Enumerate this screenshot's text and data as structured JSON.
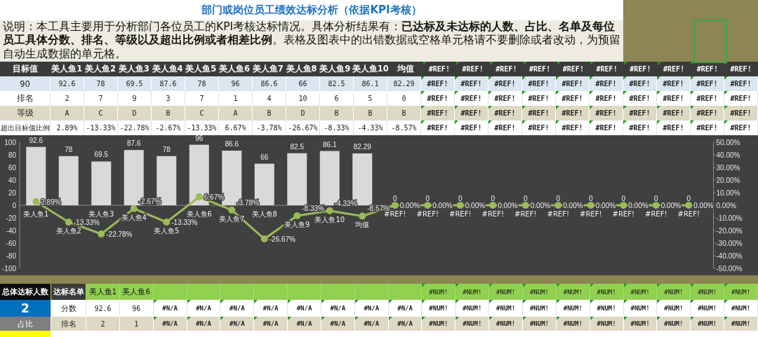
{
  "title": "部门或岗位员工绩效达标分析（依据KPI考核）",
  "description": "说明：本工具主要用于分析部门各位员工的KPI考核达标情况。具体分析结果有：**已达标及未达标的人数、占比、名单及每位员工具体分数、排名、等级以及超出比例或者相差比例**。表格及图表中的出错数据或空格单元格请不要删除或者改动，为预留自动生成数据的单元格。",
  "kpi_table": {
    "rows": [
      {
        "kind": "header",
        "label": "目标值",
        "cells": [
          "美人鱼1",
          "美人鱼2",
          "美人鱼3",
          "美人鱼4",
          "美人鱼5",
          "美人鱼6",
          "美人鱼7",
          "美人鱼8",
          "美人鱼9",
          "美人鱼10",
          "均值"
        ],
        "error_cells": [
          "#REF!",
          "#REF!",
          "#REF!",
          "#REF!",
          "#REF!",
          "#REF!",
          "#REF!",
          "#REF!",
          "#REF!",
          "#REF!"
        ]
      },
      {
        "kind": "score",
        "label": "90",
        "cells": [
          "92.6",
          "78",
          "69.5",
          "87.6",
          "78",
          "96",
          "86.6",
          "66",
          "82.5",
          "86.1",
          "82.29"
        ],
        "error_cells": [
          "#REF!",
          "#REF!",
          "#REF!",
          "#REF!",
          "#REF!",
          "#REF!",
          "#REF!",
          "#REF!",
          "#REF!",
          "#REF!"
        ]
      },
      {
        "kind": "rank",
        "label": "排名",
        "cells": [
          "2",
          "7",
          "9",
          "3",
          "7",
          "1",
          "4",
          "10",
          "6",
          "5",
          "0"
        ],
        "error_cells": [
          "#REF!",
          "#REF!",
          "#REF!",
          "#REF!",
          "#REF!",
          "#REF!",
          "#REF!",
          "#REF!",
          "#REF!",
          "#REF!"
        ]
      },
      {
        "kind": "grade",
        "label": "等级",
        "cells": [
          "A",
          "C",
          "D",
          "B",
          "C",
          "A",
          "B",
          "D",
          "B",
          "B",
          "B"
        ],
        "error_cells": [
          "#REF!",
          "#REF!",
          "#REF!",
          "#REF!",
          "#REF!",
          "#REF!",
          "#REF!",
          "#REF!",
          "#REF!",
          "#REF!"
        ]
      },
      {
        "kind": "ratio",
        "label": "超出目标值比例",
        "cells": [
          "2.89%",
          "-13.33%",
          "-22.78%",
          "-2.67%",
          "-13.33%",
          "6.67%",
          "-3.78%",
          "-26.67%",
          "-8.33%",
          "-4.33%",
          "-8.57%"
        ],
        "error_cells": [
          "#REF!",
          "#REF!",
          "#REF!",
          "#REF!",
          "#REF!",
          "#REF!",
          "#REF!",
          "#REF!",
          "#REF!",
          "#REF!"
        ]
      }
    ]
  },
  "chart": {
    "chart_data": {
      "type": "bar",
      "categories": [
        "美人鱼1",
        "美人鱼2",
        "美人鱼3",
        "美人鱼4",
        "美人鱼5",
        "美人鱼6",
        "美人鱼7",
        "美人鱼8",
        "美人鱼9",
        "美人鱼10",
        "均值",
        "#REF!",
        "#REF!",
        "#REF!",
        "#REF!",
        "#REF!",
        "#REF!",
        "#REF!",
        "#REF!",
        "#REF!",
        "#REF!"
      ],
      "series": [
        {
          "color": "#d9d9d9",
          "values": [
            92.6,
            78,
            69.5,
            87.6,
            78,
            96,
            86.6,
            66,
            82.5,
            86.1,
            82.29,
            0,
            0,
            0,
            0,
            0,
            0,
            0,
            0,
            0,
            0
          ]
        },
        {
          "type": "line",
          "axis": "y2",
          "marker": "o",
          "color": "#9bbb59",
          "values": [
            2.89,
            -13.33,
            -22.78,
            -2.67,
            -13.33,
            6.67,
            -3.78,
            -26.67,
            -8.33,
            -4.33,
            -8.57,
            0,
            0,
            0,
            0,
            0,
            0,
            0,
            0,
            0,
            0
          ],
          "value_labels": [
            "2.89%",
            "-13.33%",
            "-22.78%",
            "-2.67%",
            "-13.33%",
            "6.67%",
            "-3.78%",
            "-26.67%",
            "-8.33%",
            "-4.33%",
            "-8.57%",
            "0.00%",
            "0.00%",
            "0.00%",
            "0.00%",
            "0.00%",
            "0.00%",
            "0.00%",
            "0.00%",
            "0.00%",
            "0.00%"
          ]
        }
      ],
      "y2lim": [
        -50,
        50
      ],
      "ylim": [
        -100,
        100
      ],
      "yticks": [
        100,
        80,
        60,
        40,
        20,
        0,
        -20,
        -40,
        -60,
        -80,
        -100
      ],
      "y2ticks": [
        {
          "value": 50,
          "label": "50.00%"
        },
        {
          "value": 40,
          "label": "40.00%"
        },
        {
          "value": 30,
          "label": "30.00%"
        },
        {
          "value": 20,
          "label": "20.00%"
        },
        {
          "value": 10,
          "label": "10.00%"
        },
        {
          "value": 0,
          "label": "0.00%"
        },
        {
          "value": -10,
          "label": "-10.00%"
        },
        {
          "value": -20,
          "label": "-20.00%"
        },
        {
          "value": -30,
          "label": "-30.00%"
        },
        {
          "value": -40,
          "label": "-40.00%"
        },
        {
          "value": -50,
          "label": "-50.00%"
        }
      ],
      "data_labels": true
    }
  },
  "qualified_table": {
    "rows": [
      {
        "kind": "header",
        "side": "总体达标人数",
        "label": "达标名单",
        "cells": [
          "美人鱼1",
          "美人鱼6"
        ],
        "error_cells": [
          "#NUM!",
          "#NUM!",
          "#NUM!",
          "#NUM!",
          "#NUM!",
          "#NUM!",
          "#NUM!",
          "#NUM!",
          "#NUM!",
          "#NUM!"
        ]
      },
      {
        "kind": "score",
        "side": "2",
        "label": "分数",
        "cells": [
          "92.6",
          "96"
        ],
        "error_cells": [
          "#N/A",
          "#N/A",
          "#N/A",
          "#N/A",
          "#N/A",
          "#N/A",
          "#N/A",
          "#N/A",
          "#NUM!",
          "#NUM!",
          "#NUM!",
          "#NUM!",
          "#NUM!",
          "#NUM!",
          "#NUM!",
          "#NUM!",
          "#NUM!",
          "#NUM!"
        ]
      },
      {
        "kind": "rank",
        "side": "占比",
        "label": "排名",
        "cells": [
          "2",
          "1"
        ],
        "error_cells": [
          "#N/A",
          "#N/A",
          "#N/A",
          "#N/A",
          "#N/A",
          "#N/A",
          "#N/A",
          "#N/A",
          "#NUM!",
          "#NUM!",
          "#NUM!",
          "#NUM!",
          "#NUM!",
          "#NUM!",
          "#NUM!",
          "#NUM!",
          "#NUM!",
          "#NUM!"
        ]
      },
      {
        "kind": "grade"
      }
    ]
  }
}
